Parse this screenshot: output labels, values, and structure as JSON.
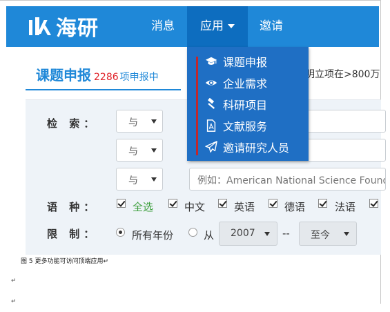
{
  "brand": {
    "name": "海研"
  },
  "nav": {
    "messages": "消息",
    "apps": "应用",
    "invite": "邀请"
  },
  "apps_menu": {
    "items": [
      {
        "label": "课题申报",
        "icon": "graduation-cap-icon"
      },
      {
        "label": "企业需求",
        "icon": "eye-icon"
      },
      {
        "label": "科研项目",
        "icon": "gavel-icon"
      },
      {
        "label": "文献服务",
        "icon": "pdf-file-icon"
      },
      {
        "label": "邀请研究人员",
        "icon": "paper-plane-icon"
      }
    ]
  },
  "header": {
    "title": "课题申报",
    "count": "2286",
    "count_suffix": "项申报中",
    "right_text": "明立项在>800万"
  },
  "search": {
    "label_search": "检 索：",
    "rows": [
      {
        "operator": "与",
        "placeholder": ""
      },
      {
        "operator": "与",
        "placeholder": ""
      },
      {
        "operator": "与",
        "placeholder": "例如：American National Science Foundation"
      }
    ],
    "label_language": "语 种：",
    "languages": [
      {
        "label": "全选",
        "checked": true
      },
      {
        "label": "中文",
        "checked": true
      },
      {
        "label": "英语",
        "checked": true
      },
      {
        "label": "德语",
        "checked": true
      },
      {
        "label": "法语",
        "checked": true
      }
    ],
    "label_limit": "限 制：",
    "year_all": "所有年份",
    "year_from": "从",
    "year_start": "2007",
    "range_sep": "--",
    "year_end": "至今"
  },
  "caption": "图 5 更多功能可访问顶端应用↵",
  "paragraph_marks": [
    "↵",
    "↵"
  ],
  "colors": {
    "brand_blue": "#1f88d8",
    "menu_blue": "#1f6fc4",
    "count_red": "#e0232a",
    "menu_accent_red": "#c0282d"
  }
}
